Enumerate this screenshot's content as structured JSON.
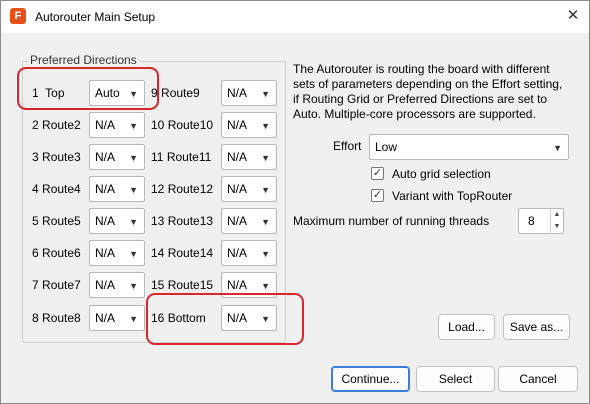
{
  "window": {
    "title": "Autorouter Main Setup",
    "app_icon_glyph": "F",
    "close_glyph": "✕"
  },
  "preferred_directions": {
    "label": "Preferred Directions",
    "left_column": [
      {
        "num": "1",
        "name": "Top",
        "value": "Auto"
      },
      {
        "num": "2",
        "name": "Route2",
        "value": "N/A"
      },
      {
        "num": "3",
        "name": "Route3",
        "value": "N/A"
      },
      {
        "num": "4",
        "name": "Route4",
        "value": "N/A"
      },
      {
        "num": "5",
        "name": "Route5",
        "value": "N/A"
      },
      {
        "num": "6",
        "name": "Route6",
        "value": "N/A"
      },
      {
        "num": "7",
        "name": "Route7",
        "value": "N/A"
      },
      {
        "num": "8",
        "name": "Route8",
        "value": "N/A"
      }
    ],
    "right_column": [
      {
        "num": "9",
        "name": "Route9",
        "value": "N/A"
      },
      {
        "num": "10",
        "name": "Route10",
        "value": "N/A"
      },
      {
        "num": "11",
        "name": "Route11",
        "value": "N/A"
      },
      {
        "num": "12",
        "name": "Route12",
        "value": "N/A"
      },
      {
        "num": "13",
        "name": "Route13",
        "value": "N/A"
      },
      {
        "num": "14",
        "name": "Route14",
        "value": "N/A"
      },
      {
        "num": "15",
        "name": "Route15",
        "value": "N/A"
      },
      {
        "num": "16",
        "name": "Bottom",
        "value": "N/A"
      }
    ]
  },
  "description": {
    "lines": [
      "The Autorouter is routing the board with different",
      "sets of parameters depending on the Effort setting,",
      "if Routing Grid or Preferred Directions are set to",
      "Auto. Multiple-core processors are supported."
    ]
  },
  "effort": {
    "label": "Effort",
    "value": "Low"
  },
  "options": {
    "auto_grid": {
      "label": "Auto grid selection",
      "checked": true
    },
    "variant_toprouter": {
      "label": "Variant with TopRouter",
      "checked": true
    }
  },
  "threads": {
    "label": "Maximum number of running threads",
    "value": "8"
  },
  "buttons": {
    "load": "Load...",
    "save_as": "Save as...",
    "continue": "Continue...",
    "select": "Select",
    "cancel": "Cancel"
  },
  "glyphs": {
    "dropdown_arrow": "▼",
    "check_mark": "✓",
    "spin_up": "▲",
    "spin_down": "▼"
  },
  "colors": {
    "highlight": "#d9262c",
    "primary_border": "#3c7fd8"
  }
}
